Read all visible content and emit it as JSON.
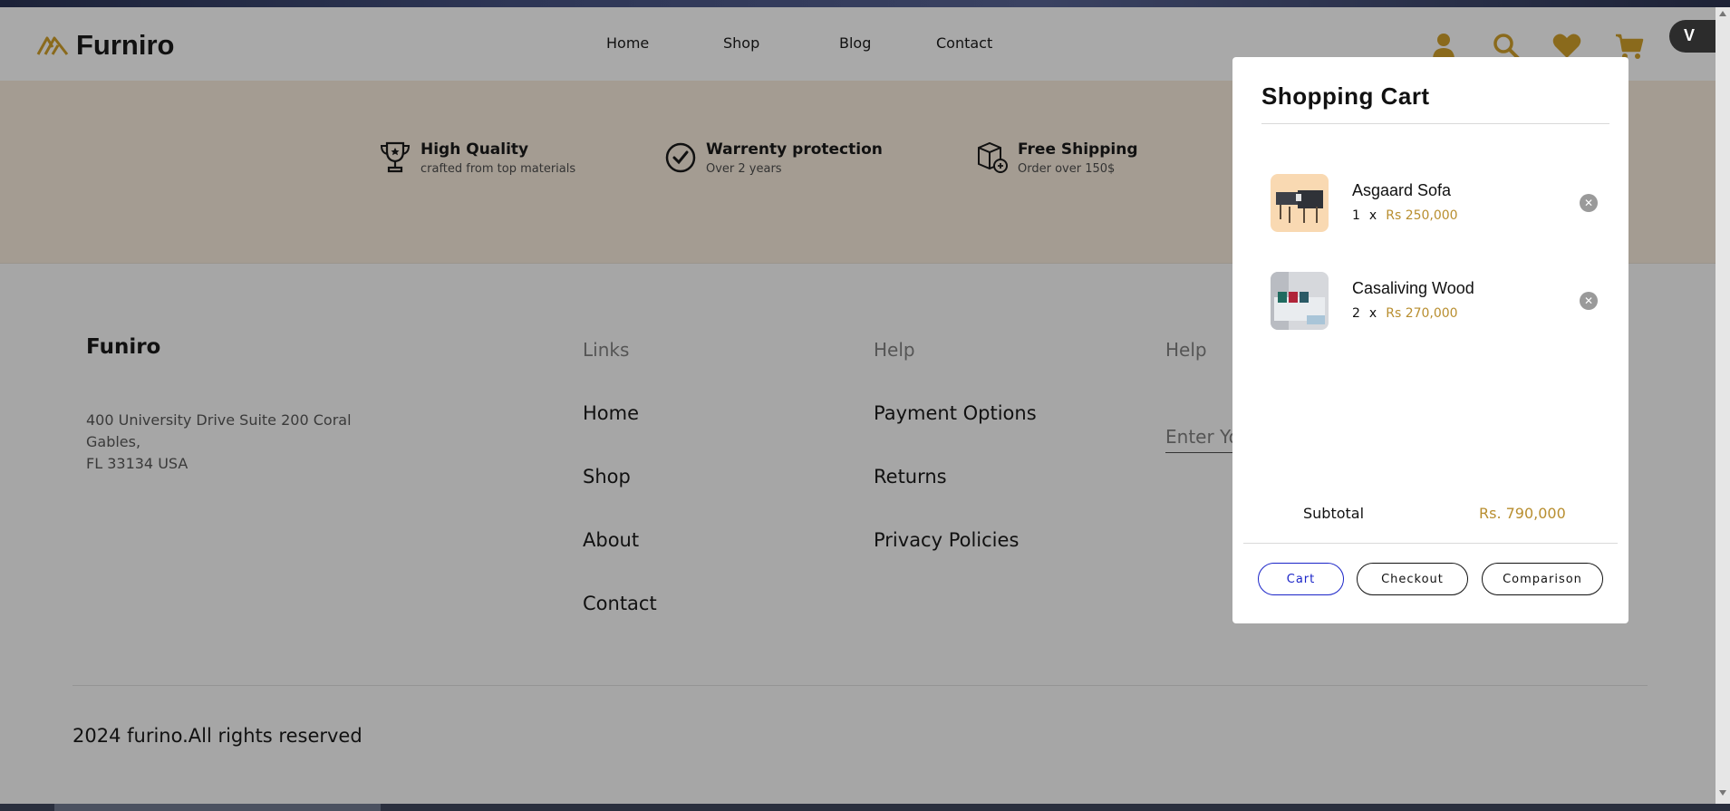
{
  "header": {
    "brand": "Furniro",
    "nav": [
      "Home",
      "Shop",
      "Blog",
      "Contact"
    ],
    "icons": [
      "user-icon",
      "search-icon",
      "heart-icon",
      "cart-icon"
    ],
    "ext_label": "V"
  },
  "features": [
    {
      "icon": "trophy-icon",
      "title": "High Quality",
      "subtitle": "crafted from top materials"
    },
    {
      "icon": "verified-icon",
      "title": "Warrenty protection",
      "subtitle": "Over 2 years"
    },
    {
      "icon": "shipping-icon",
      "title": "Free Shipping",
      "subtitle": "Order over 150$"
    }
  ],
  "footer": {
    "brand": "Funiro",
    "address": [
      "400 University Drive Suite 200 Coral",
      "Gables,",
      "FL 33134 USA"
    ],
    "links_title": "Links",
    "links": [
      "Home",
      "Shop",
      "About",
      "Contact"
    ],
    "help_title": "Help",
    "help_links": [
      "Payment Options",
      "Returns",
      "Privacy Policies"
    ],
    "newsletter_title": "Help",
    "newsletter_placeholder": "Enter Your Email Address",
    "copyright": "2024 furino.All rights reserved"
  },
  "cart": {
    "title": "Shopping Cart",
    "items": [
      {
        "name": "Asgaard Sofa",
        "qty": "1",
        "x": "x",
        "price": "Rs 250,000"
      },
      {
        "name": "Casaliving Wood",
        "qty": "2",
        "x": "x",
        "price": "Rs 270,000"
      }
    ],
    "subtotal_label": "Subtotal",
    "subtotal_value": "Rs. 790,000",
    "buttons": {
      "cart": "Cart",
      "checkout": "Checkout",
      "comparison": "Comparison"
    }
  },
  "colors": {
    "accent": "#b88e2f",
    "band": "#a49c92",
    "overlay": "#a6a6a6",
    "cart_button": "#1a24c8"
  }
}
